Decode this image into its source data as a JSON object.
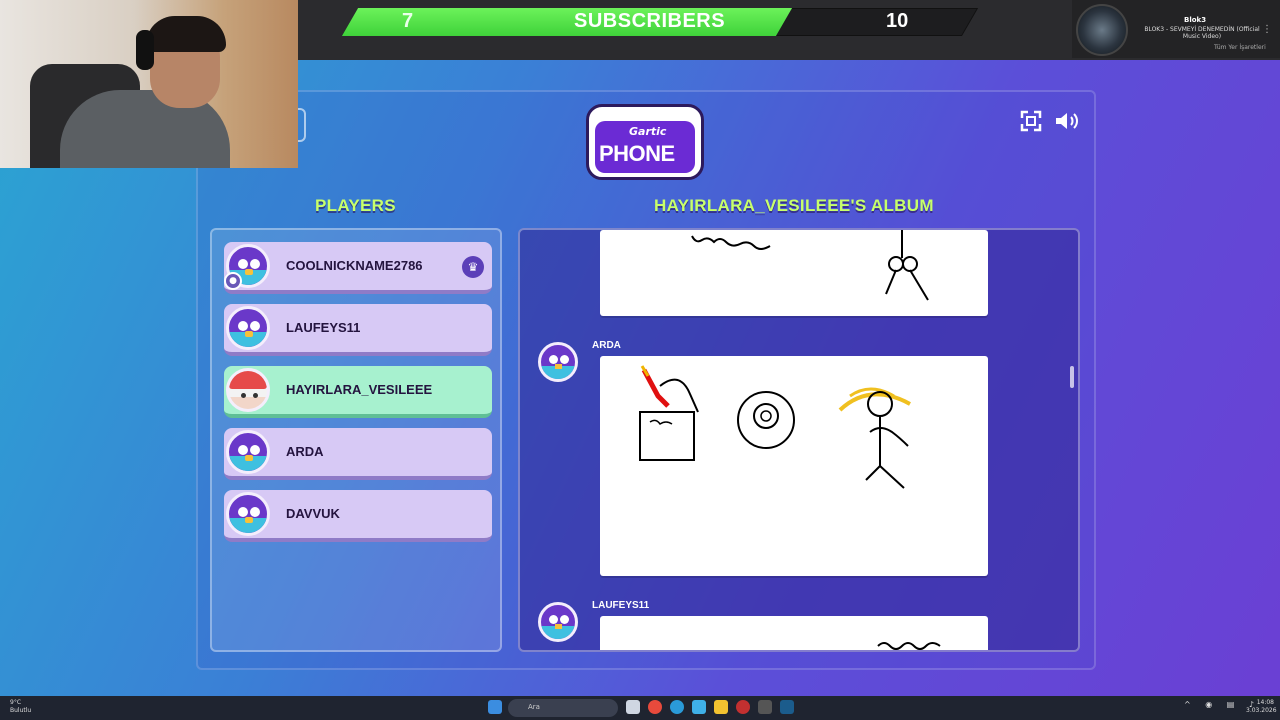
{
  "overlay": {
    "subscriber_current": "7",
    "subscriber_label": "SUBSCRIBERS",
    "subscriber_goal": "10",
    "subscriber_progress_pct": 70
  },
  "music": {
    "artist": "Blok3",
    "title": "BLOK3 - SEVMEYİ DENEMEDİN (Official Music Video)"
  },
  "bookmarks_label": "Tüm Yer İşaretleri",
  "game": {
    "logo_top": "Gartic",
    "logo_main": "PHONE",
    "players_title": "PLAYERS",
    "album_title": "HAYIRLARA_VESILEEE'S ALBUM",
    "players": [
      {
        "name": "COOLNICKNAME2786",
        "host": true,
        "active": false,
        "avatar": "bird"
      },
      {
        "name": "LAUFEYS11",
        "host": false,
        "active": false,
        "avatar": "bird"
      },
      {
        "name": "HAYIRLARA_VESILEEE",
        "host": false,
        "active": true,
        "avatar": "mushroom"
      },
      {
        "name": "ARDA",
        "host": false,
        "active": false,
        "avatar": "bird"
      },
      {
        "name": "DAVVUK",
        "host": false,
        "active": false,
        "avatar": "bird"
      }
    ],
    "album_entries": [
      {
        "author": "ARDA"
      },
      {
        "author": "LAUFEYS11"
      }
    ],
    "icons": {
      "fullscreen": "fullscreen-icon",
      "sound": "speaker-icon",
      "crown": "crown-icon"
    }
  },
  "taskbar": {
    "weather_temp": "9°C",
    "weather_desc": "Bulutlu",
    "search_placeholder": "Ara",
    "time": "14:08",
    "date": "3.03.2026"
  }
}
